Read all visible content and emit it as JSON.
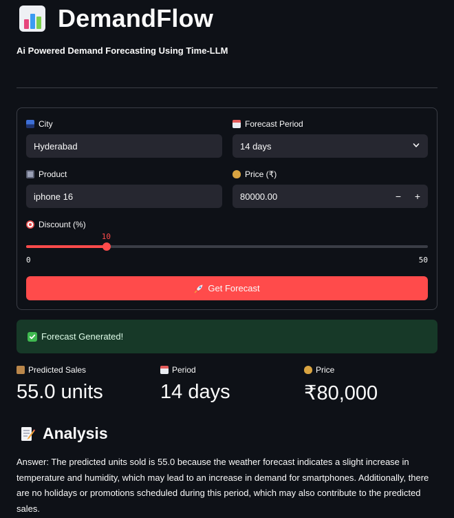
{
  "app": {
    "title": "DemandFlow",
    "subtitle": "Ai Powered Demand Forecasting Using Time-LLM",
    "logo_icon": "bar-chart-icon"
  },
  "form": {
    "city": {
      "label": "City",
      "icon": "cityscape-icon",
      "value": "Hyderabad"
    },
    "forecast_period": {
      "label": "Forecast Period",
      "icon": "calendar-icon",
      "value": "14 days"
    },
    "product": {
      "label": "Product",
      "icon": "calculator-icon",
      "value": "iphone 16"
    },
    "price": {
      "label": "Price (₹)",
      "icon": "money-bag-icon",
      "value": "80000.00",
      "minus": "−",
      "plus": "+"
    },
    "discount": {
      "label": "Discount (%)",
      "icon": "target-icon",
      "value": 10,
      "min": 0,
      "max": 50
    },
    "submit": {
      "label": "Get Forecast",
      "icon": "rocket-icon"
    }
  },
  "status": {
    "message": "Forecast Generated!",
    "icon": "check-mark-icon"
  },
  "metrics": [
    {
      "label": "Predicted Sales",
      "icon": "package-icon",
      "value": "55.0 units"
    },
    {
      "label": "Period",
      "icon": "calendar-icon",
      "value": "14 days"
    },
    {
      "label": "Price",
      "icon": "money-bag-icon",
      "value": "₹80,000"
    }
  ],
  "analysis": {
    "heading": "Analysis",
    "icon": "memo-icon",
    "text": "Answer: The predicted units sold is 55.0 because the weather forecast indicates a slight increase in temperature and humidity, which may lead to an increase in demand for smartphones. Additionally, there are no holidays or promotions scheduled during this period, which may also contribute to the predicted sales."
  },
  "colors": {
    "background": "#0e1117",
    "accent": "#ff4b4b",
    "input_bg": "#262730",
    "success_bg": "#173928"
  }
}
